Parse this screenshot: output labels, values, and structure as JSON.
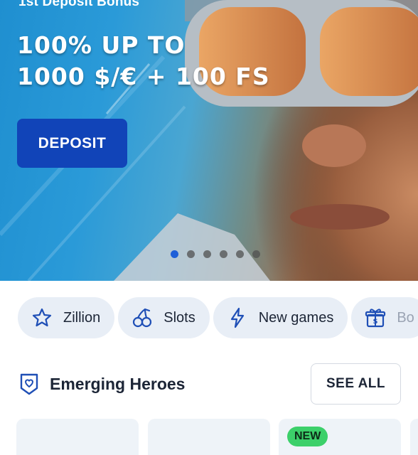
{
  "hero": {
    "eyebrow": "1st Deposit Bonus",
    "title_line1": "100% UP TO",
    "title_line2": "1000 $/€ + 100 FS",
    "cta_label": "DEPOSIT",
    "slide_count": 6,
    "active_slide": 1
  },
  "categories": [
    {
      "label": "Zillion",
      "icon": "star-icon"
    },
    {
      "label": "Slots",
      "icon": "cherries-icon"
    },
    {
      "label": "New games",
      "icon": "lightning-icon"
    },
    {
      "label": "Bo",
      "icon": "gift-icon"
    }
  ],
  "section": {
    "title": "Emerging Heroes",
    "see_all_label": "SEE ALL",
    "icon": "heart-badge-icon"
  },
  "cards": {
    "badge_label": "NEW"
  },
  "colors": {
    "accent": "#1144b8",
    "chip_bg": "#e8eef6",
    "new_badge": "#3cd06a",
    "active_dot": "#1e5fd8"
  }
}
